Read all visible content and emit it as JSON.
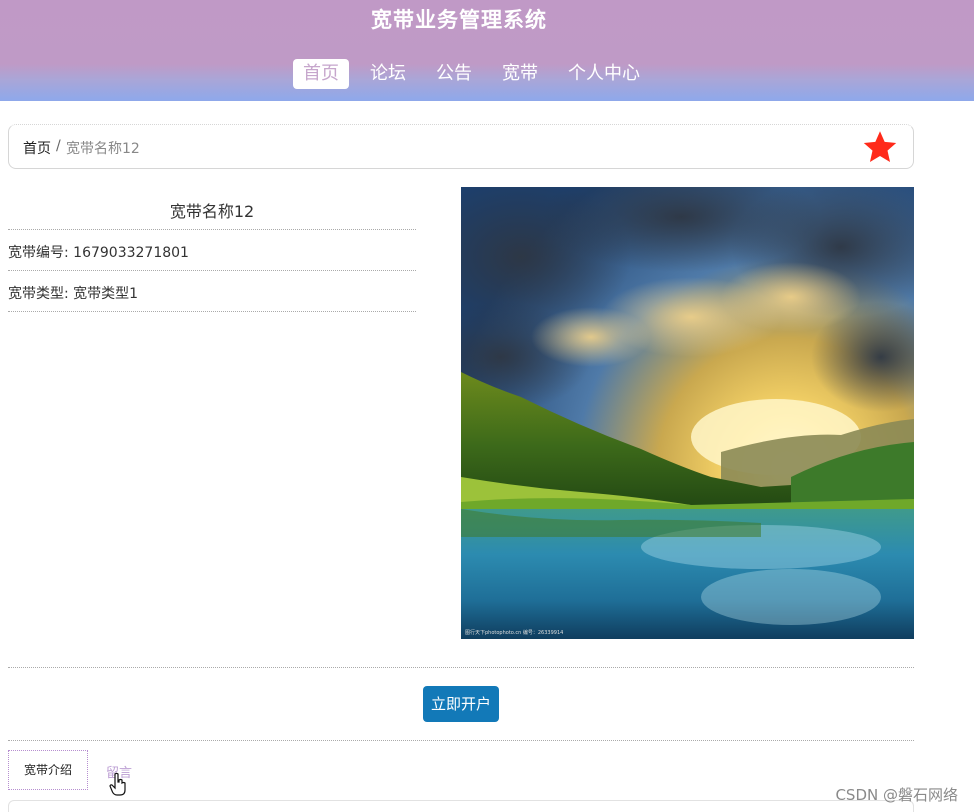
{
  "header": {
    "site_title": "宽带业务管理系统",
    "nav": [
      {
        "label": "首页"
      },
      {
        "label": "论坛"
      },
      {
        "label": "公告"
      },
      {
        "label": "宽带"
      },
      {
        "label": "个人中心"
      }
    ]
  },
  "breadcrumb": {
    "home": "首页",
    "separator": "/",
    "current": "宽带名称12"
  },
  "product": {
    "name": "宽带名称12",
    "number_line": "宽带编号: 1679033271801",
    "type_line": "宽带类型: 宽带类型1",
    "image_watermark": "图行天下photophoto.cn  编号：26339914"
  },
  "actions": {
    "open_button": "立即开户"
  },
  "tabs": {
    "intro": "宽带介绍",
    "message": "留言"
  },
  "footer": {
    "credit": "CSDN @磐石网络"
  },
  "colors": {
    "header_top": "#c099c6",
    "header_bottom": "#8fa8ea",
    "star": "#ff2a1a",
    "button": "#1279b8"
  }
}
